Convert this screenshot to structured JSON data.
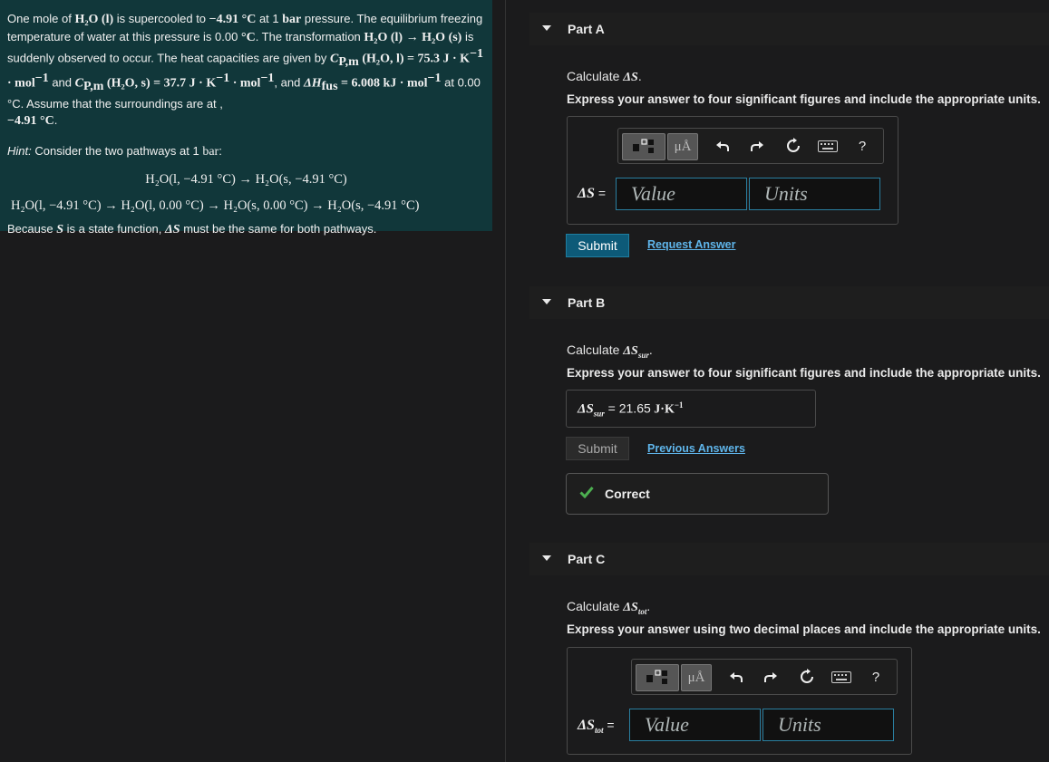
{
  "problem": {
    "intro_parts": [
      "One mole of ",
      "H₂O (l)",
      " is supercooled to ",
      "−4.91 °C",
      " at 1 ",
      "bar",
      " pressure. The equilibrium freezing temperature of water at this pressure is 0.00 ",
      "°C",
      ". The transformation ",
      "H₂O (l) → H₂O (s)",
      " is suddenly observed to occur. The heat capacities are given by ",
      "C",
      "P,m",
      " (H₂O, l) = 75.3 J · K",
      "−1",
      " · mol",
      "−1",
      " and ",
      "C",
      "P,m",
      " (H₂O, s) = 37.7 J · K",
      "−1",
      " · mol",
      "−1",
      ", and ",
      "ΔH",
      "fus",
      " = 6.008 kJ · mol",
      "−1",
      " at 0.00 °C",
      ". Assume that the surroundings are at , ",
      "−4.91 °C",
      "."
    ],
    "hint_label": "Hint:",
    "hint_text": " Consider the two pathways at 1 ",
    "hint_unit": "bar",
    "hint_end": ":",
    "pathway1": "H₂O(l, −4.91 °C) → H₂O(s, −4.91 °C)",
    "pathway2": "H₂O(l, −4.91 °C) → H₂O(l, 0.00 °C) → H₂O(s, 0.00 °C) → H₂O(s, −4.91 °C)",
    "note_a": "Because ",
    "note_S": "S",
    "note_b": " is a state function, ",
    "note_dS": "ΔS",
    "note_c": " must be the same for both pathways."
  },
  "partA": {
    "title": "Part A",
    "calc_prefix": "Calculate ",
    "calc_symbol": "ΔS",
    "calc_suffix": ".",
    "instruction": "Express your answer to four significant figures and include the appropriate units.",
    "label_symbol": "ΔS",
    "label_eq": " =",
    "value_placeholder": "Value",
    "units_placeholder": "Units",
    "submit": "Submit",
    "request": "Request Answer"
  },
  "partB": {
    "title": "Part B",
    "calc_prefix": "Calculate ",
    "calc_symbol": "ΔS",
    "calc_sub": "sur",
    "calc_suffix": ".",
    "instruction": "Express your answer to four significant figures and include the appropriate units.",
    "result_symbol": "ΔS",
    "result_sub": "sur",
    "result_eq": " = ",
    "result_value": "21.65",
    "result_unit": " J·K",
    "result_exp": "−1",
    "submit": "Submit",
    "previous": "Previous Answers",
    "correct": "Correct"
  },
  "partC": {
    "title": "Part C",
    "calc_prefix": "Calculate ",
    "calc_symbol": "ΔS",
    "calc_sub": "tot",
    "calc_suffix": ".",
    "instruction": "Express your answer using two decimal places and include the appropriate units.",
    "label_symbol": "ΔS",
    "label_sub": "tot",
    "label_eq": " =",
    "value_placeholder": "Value",
    "units_placeholder": "Units"
  },
  "toolbar": {
    "mu_label": "μÅ",
    "help_label": "?"
  },
  "colors": {
    "problem_bg": "#11373a",
    "accent": "#0d5a78",
    "link": "#5fb5ea",
    "check": "#4caf50"
  }
}
